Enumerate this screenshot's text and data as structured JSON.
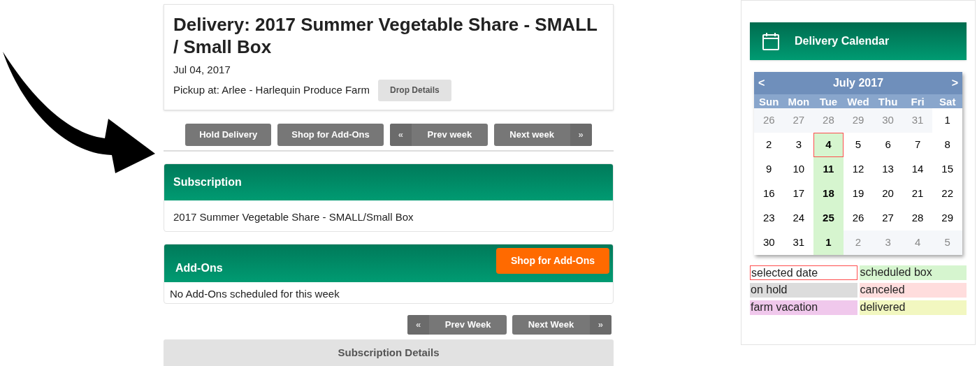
{
  "delivery": {
    "title": "Delivery: 2017 Summer Vegetable Share - SMALL / Small Box",
    "date": "Jul 04, 2017",
    "pickup": "Pickup at: Arlee - Harlequin Produce Farm",
    "details_button": "Drop Details"
  },
  "actions": [
    {
      "kind": "plain",
      "label": "Hold Delivery"
    },
    {
      "kind": "plain",
      "label": "Shop for Add-Ons"
    },
    {
      "kind": "prev",
      "label": "Prev week",
      "icon": "«"
    },
    {
      "kind": "next",
      "label": "Next week",
      "icon": "»"
    }
  ],
  "subscription": {
    "title": "Subscription",
    "text": "2017 Summer Vegetable Share - SMALL/Small Box"
  },
  "addons": {
    "title": "Add-Ons",
    "button": "Shop for Add-Ons",
    "text": "No Add-Ons scheduled for this week"
  },
  "week_nav": [
    {
      "kind": "prev",
      "label": "Prev Week",
      "icon": "«"
    },
    {
      "kind": "next",
      "label": "Next Week",
      "icon": "»"
    }
  ],
  "details_bar": "Subscription Details",
  "calendar": {
    "title": "Delivery Calendar",
    "prev": "<",
    "month": "July 2017",
    "next": ">",
    "weekdays": [
      "Sun",
      "Mon",
      "Tue",
      "Wed",
      "Thu",
      "Fri",
      "Sat"
    ],
    "days": [
      {
        "day": "26",
        "muted": true,
        "scheduled": false,
        "selected": false
      },
      {
        "day": "27",
        "muted": true,
        "scheduled": false,
        "selected": false
      },
      {
        "day": "28",
        "muted": true,
        "scheduled": false,
        "selected": false
      },
      {
        "day": "29",
        "muted": true,
        "scheduled": false,
        "selected": false
      },
      {
        "day": "30",
        "muted": true,
        "scheduled": false,
        "selected": false
      },
      {
        "day": "31",
        "muted": true,
        "scheduled": false,
        "selected": false
      },
      {
        "day": "1",
        "muted": false,
        "scheduled": false,
        "selected": false
      },
      {
        "day": "2",
        "muted": false,
        "scheduled": false,
        "selected": false
      },
      {
        "day": "3",
        "muted": false,
        "scheduled": false,
        "selected": false
      },
      {
        "day": "4",
        "muted": false,
        "scheduled": true,
        "selected": true
      },
      {
        "day": "5",
        "muted": false,
        "scheduled": false,
        "selected": false
      },
      {
        "day": "6",
        "muted": false,
        "scheduled": false,
        "selected": false
      },
      {
        "day": "7",
        "muted": false,
        "scheduled": false,
        "selected": false
      },
      {
        "day": "8",
        "muted": false,
        "scheduled": false,
        "selected": false
      },
      {
        "day": "9",
        "muted": false,
        "scheduled": false,
        "selected": false
      },
      {
        "day": "10",
        "muted": false,
        "scheduled": false,
        "selected": false
      },
      {
        "day": "11",
        "muted": false,
        "scheduled": true,
        "selected": false
      },
      {
        "day": "12",
        "muted": false,
        "scheduled": false,
        "selected": false
      },
      {
        "day": "13",
        "muted": false,
        "scheduled": false,
        "selected": false
      },
      {
        "day": "14",
        "muted": false,
        "scheduled": false,
        "selected": false
      },
      {
        "day": "15",
        "muted": false,
        "scheduled": false,
        "selected": false
      },
      {
        "day": "16",
        "muted": false,
        "scheduled": false,
        "selected": false
      },
      {
        "day": "17",
        "muted": false,
        "scheduled": false,
        "selected": false
      },
      {
        "day": "18",
        "muted": false,
        "scheduled": true,
        "selected": false
      },
      {
        "day": "19",
        "muted": false,
        "scheduled": false,
        "selected": false
      },
      {
        "day": "20",
        "muted": false,
        "scheduled": false,
        "selected": false
      },
      {
        "day": "21",
        "muted": false,
        "scheduled": false,
        "selected": false
      },
      {
        "day": "22",
        "muted": false,
        "scheduled": false,
        "selected": false
      },
      {
        "day": "23",
        "muted": false,
        "scheduled": false,
        "selected": false
      },
      {
        "day": "24",
        "muted": false,
        "scheduled": false,
        "selected": false
      },
      {
        "day": "25",
        "muted": false,
        "scheduled": true,
        "selected": false
      },
      {
        "day": "26",
        "muted": false,
        "scheduled": false,
        "selected": false
      },
      {
        "day": "27",
        "muted": false,
        "scheduled": false,
        "selected": false
      },
      {
        "day": "28",
        "muted": false,
        "scheduled": false,
        "selected": false
      },
      {
        "day": "29",
        "muted": false,
        "scheduled": false,
        "selected": false
      },
      {
        "day": "30",
        "muted": false,
        "scheduled": false,
        "selected": false
      },
      {
        "day": "31",
        "muted": false,
        "scheduled": false,
        "selected": false
      },
      {
        "day": "1",
        "muted": false,
        "scheduled": true,
        "selected": false
      },
      {
        "day": "2",
        "muted": true,
        "scheduled": false,
        "selected": false
      },
      {
        "day": "3",
        "muted": true,
        "scheduled": false,
        "selected": false
      },
      {
        "day": "4",
        "muted": true,
        "scheduled": false,
        "selected": false
      },
      {
        "day": "5",
        "muted": true,
        "scheduled": false,
        "selected": false
      }
    ]
  },
  "legend": [
    {
      "kind": "outline",
      "label": "selected date",
      "color": "#ff4d4d"
    },
    {
      "kind": "fill",
      "label": "scheduled box",
      "color": "#d6f5cf"
    },
    {
      "kind": "fill",
      "label": "on hold",
      "color": "#dcdcdc"
    },
    {
      "kind": "fill",
      "label": "canceled",
      "color": "#ffdddd"
    },
    {
      "kind": "fill",
      "label": "farm vacation",
      "color": "#f0c8ec"
    },
    {
      "kind": "fill",
      "label": "delivered",
      "color": "#f2f7c0"
    }
  ]
}
